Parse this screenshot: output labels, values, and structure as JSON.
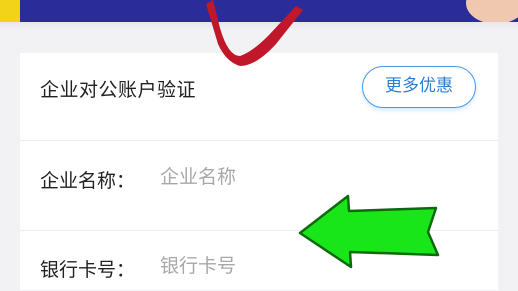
{
  "form": {
    "title": "企业对公账户验证",
    "promo_button": "更多优惠",
    "fields": [
      {
        "label": "企业名称：",
        "placeholder": "企业名称",
        "value": ""
      },
      {
        "label": "银行卡号：",
        "placeholder": "银行卡号",
        "value": ""
      }
    ]
  },
  "annotations": {
    "check_color": "#c0182a",
    "arrow_color": "#19e619",
    "arrow_icon": "left-arrow-icon",
    "check_icon": "check-mark-icon"
  },
  "colors": {
    "banner": "#2a2d99",
    "accent": "#2a7fd4",
    "placeholder": "#a8a8a8"
  }
}
